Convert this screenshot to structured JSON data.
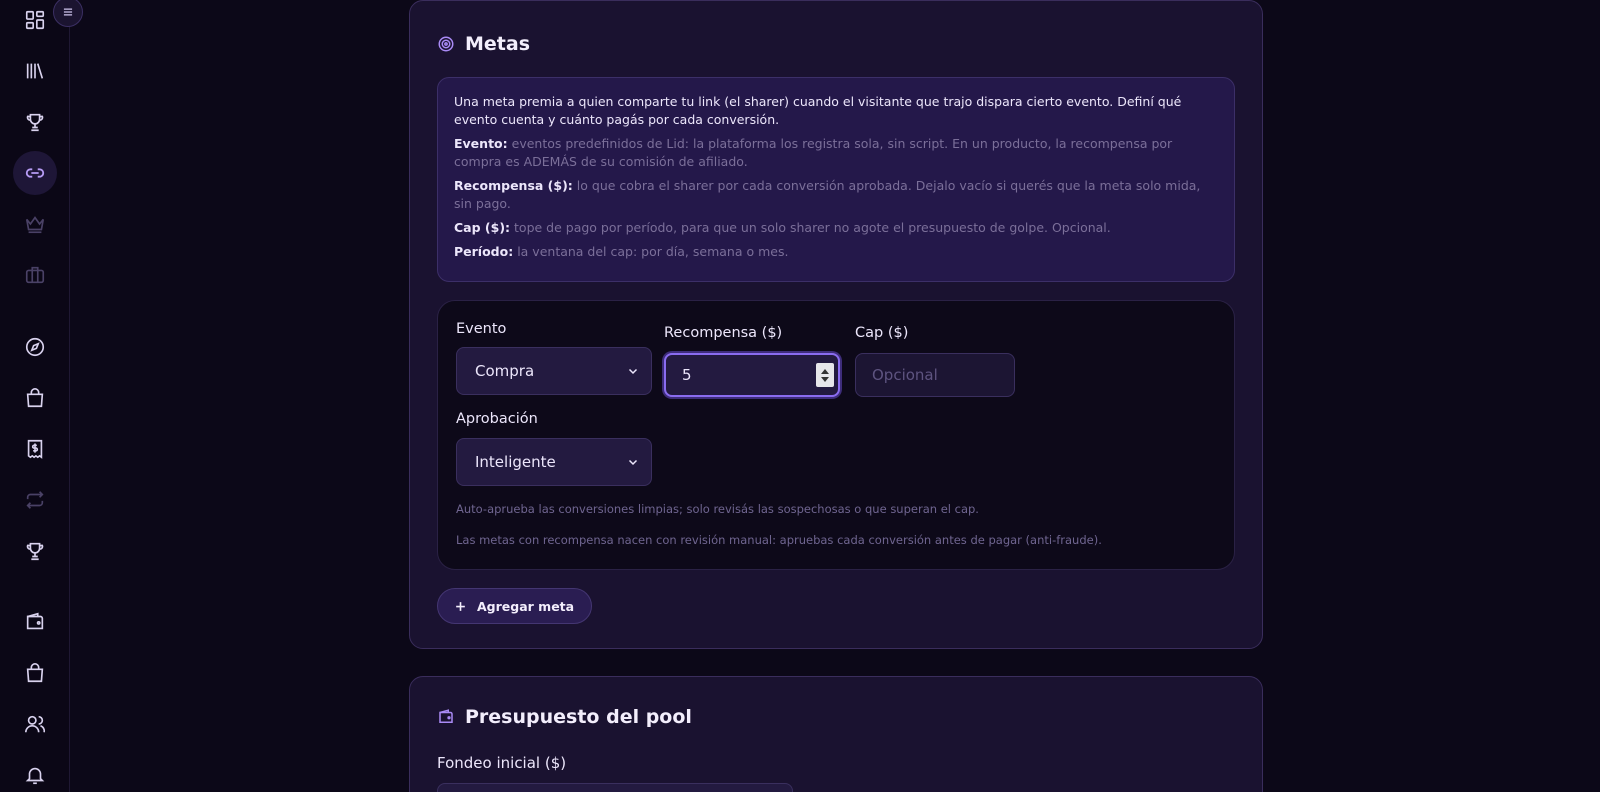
{
  "sidebar": {
    "items": [
      {
        "icon": "dashboard-icon"
      },
      {
        "icon": "library-icon"
      },
      {
        "icon": "trophy-icon"
      },
      {
        "icon": "link-icon",
        "active": true
      },
      {
        "icon": "crown-icon"
      },
      {
        "icon": "briefcase-icon"
      },
      {
        "icon": "compass-icon"
      },
      {
        "icon": "shopping-bag-icon"
      },
      {
        "icon": "receipt-icon"
      },
      {
        "icon": "repeat-icon"
      },
      {
        "icon": "trophy-icon"
      },
      {
        "icon": "wallet-icon"
      },
      {
        "icon": "shopping-bag-icon"
      },
      {
        "icon": "users-icon"
      },
      {
        "icon": "bell-icon"
      }
    ]
  },
  "metas": {
    "title": "Metas",
    "intro": "Una meta premia a quien comparte tu link (el sharer) cuando el visitante que trajo dispara cierto evento. Definí qué evento cuenta y cuánto pagás por cada conversión.",
    "definitions": [
      {
        "term": "Evento:",
        "text": "eventos predefinidos de Lid: la plataforma los registra sola, sin script. En un producto, la recompensa por compra es ADEMÁS de su comisión de afiliado."
      },
      {
        "term": "Recompensa ($):",
        "text": "lo que cobra el sharer por cada conversión aprobada. Dejalo vacío si querés que la meta solo mida, sin pago."
      },
      {
        "term": "Cap ($):",
        "text": "tope de pago por período, para que un solo sharer no agote el presupuesto de golpe. Opcional."
      },
      {
        "term": "Período:",
        "text": "la ventana del cap: por día, semana o mes."
      }
    ],
    "row": {
      "evento_label": "Evento",
      "evento_value": "Compra",
      "recompensa_label": "Recompensa ($)",
      "recompensa_value": "5",
      "cap_label": "Cap ($)",
      "cap_placeholder": "Opcional",
      "aprobacion_label": "Aprobación",
      "aprobacion_value": "Inteligente",
      "hint_1": "Auto-aprueba las conversiones limpias; solo revisás las sospechosas o que superan el cap.",
      "hint_2": "Las metas con recompensa nacen con revisión manual: apruebas cada conversión antes de pagar (anti-fraude)."
    },
    "add_button": "Agregar meta"
  },
  "budget": {
    "title": "Presupuesto del pool",
    "fondeo_label": "Fondeo inicial ($)"
  },
  "colors": {
    "accent": "#8a6cf0",
    "card_bg": "#1a1230",
    "page_bg": "#0c0818"
  }
}
